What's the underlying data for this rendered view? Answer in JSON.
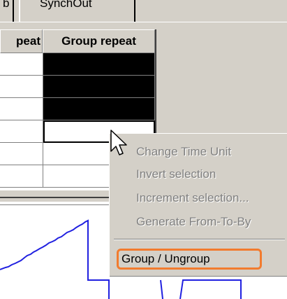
{
  "tabs": {
    "partial_label": "b",
    "synchout_label": "SynchOut"
  },
  "grid": {
    "columns": [
      "peat",
      "Group repeat"
    ],
    "rows": [
      {
        "left": "",
        "right": "",
        "state": "black"
      },
      {
        "left": "",
        "right": "",
        "state": "black"
      },
      {
        "left": "",
        "right": "",
        "state": "black"
      },
      {
        "left": "",
        "right": "",
        "state": "focus"
      },
      {
        "left": "",
        "right": "",
        "state": "white"
      },
      {
        "left": "",
        "right": "",
        "state": "white"
      }
    ]
  },
  "context_menu": {
    "items": [
      {
        "label": "Change Time Unit",
        "enabled": false
      },
      {
        "label": "Invert selection",
        "enabled": false
      },
      {
        "label": "Increment selection...",
        "enabled": false
      },
      {
        "label": "Generate From-To-By",
        "enabled": false
      },
      {
        "label": "Group / Ungroup",
        "enabled": true,
        "highlighted": true
      }
    ]
  },
  "colors": {
    "highlight": "#f27b2e",
    "plot_line": "#2020e0"
  },
  "icons": {
    "cursor": "arrow-cursor-icon"
  }
}
